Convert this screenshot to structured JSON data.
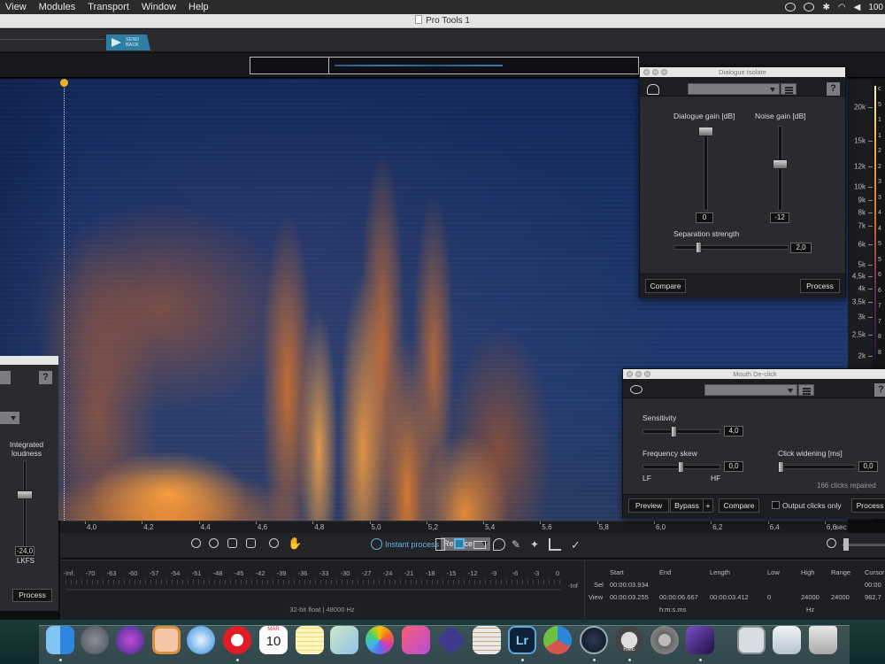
{
  "menubar": {
    "items": [
      "View",
      "Modules",
      "Transport",
      "Window",
      "Help"
    ],
    "battery": "100"
  },
  "window": {
    "title": "Pro Tools 1"
  },
  "toolbar": {
    "send_back": [
      "SEND",
      "BACK"
    ]
  },
  "spectrogram": {
    "freq_labels": [
      "20k",
      "15k",
      "12k",
      "10k",
      "9k",
      "8k",
      "7k",
      "6k",
      "5k",
      "4,5k",
      "4k",
      "3,5k",
      "3k",
      "2,5k",
      "2k"
    ],
    "colorbar_labels": [
      "c",
      "5",
      "1",
      "1",
      "2",
      "2",
      "3",
      "3",
      "4",
      "4",
      "5",
      "5",
      "6",
      "6",
      "7",
      "7",
      "8",
      "8"
    ],
    "time_labels": [
      "4,0",
      "4,2",
      "4,4",
      "4,6",
      "4,8",
      "5,0",
      "5,2",
      "5,4",
      "5,6",
      "5,8",
      "6,0",
      "6,2",
      "6,4",
      "6,6"
    ],
    "time_unit": "sec"
  },
  "tools": {
    "instant_process": "Instant process",
    "mode": "Replace"
  },
  "meters": {
    "scale": [
      "-Inf.",
      "-70",
      "-63",
      "-60",
      "-57",
      "-54",
      "-51",
      "-48",
      "-45",
      "-42",
      "-39",
      "-36",
      "-33",
      "-30",
      "-27",
      "-24",
      "-21",
      "-18",
      "-15",
      "-12",
      "-9",
      "-6",
      "-3",
      "0"
    ],
    "inf_right": "-Inf",
    "format": "32-bit float | 48000 Hz"
  },
  "selection": {
    "headers": {
      "start": "Start",
      "end": "End",
      "length": "Length",
      "low": "Low",
      "high": "High",
      "range": "Range",
      "cursor": "Cursor"
    },
    "sel_label": "Sel",
    "view_label": "View",
    "sel_start": "00:00:03.934",
    "view_start": "00:00:03.255",
    "view_end": "00:00:06.667",
    "view_length": "00:00:03.412",
    "low": "0",
    "high": "24000",
    "range": "24000",
    "cursor_1": "00:00",
    "cursor_2": "982,7",
    "time_unit": "h:m:s.ms",
    "freq_unit": "Hz"
  },
  "loudness_panel": {
    "label": "Integrated loudness",
    "value": "-24,0",
    "unit": "LKFS",
    "process": "Process",
    "help": "?"
  },
  "dialogue_isolate": {
    "title": "Dialogue Isolate",
    "help": "?",
    "dialogue_gain_label": "Dialogue gain [dB]",
    "noise_gain_label": "Noise gain [dB]",
    "dialogue_gain": "0",
    "noise_gain": "-12",
    "separation_label": "Separation strength",
    "separation": "2,0",
    "compare": "Compare",
    "process": "Process"
  },
  "mouth_declick": {
    "title": "Mouth De-click",
    "help": "?",
    "sensitivity_label": "Sensitivity",
    "sensitivity": "4,0",
    "freq_skew_label": "Frequency skew",
    "freq_skew": "0,0",
    "lf": "LF",
    "hf": "HF",
    "click_widening_label": "Click widening [ms]",
    "click_widening": "0,0",
    "clicks_repaired": "166 clicks repaired",
    "preview": "Preview",
    "bypass": "Bypass",
    "plus": "+",
    "compare": "Compare",
    "output_clicks_only": "Output clicks only",
    "process": "Process"
  },
  "dock": {
    "calendar_month": "MAR",
    "calendar_day": "10",
    "lightroom": "Lr",
    "rme_label": "RME"
  }
}
